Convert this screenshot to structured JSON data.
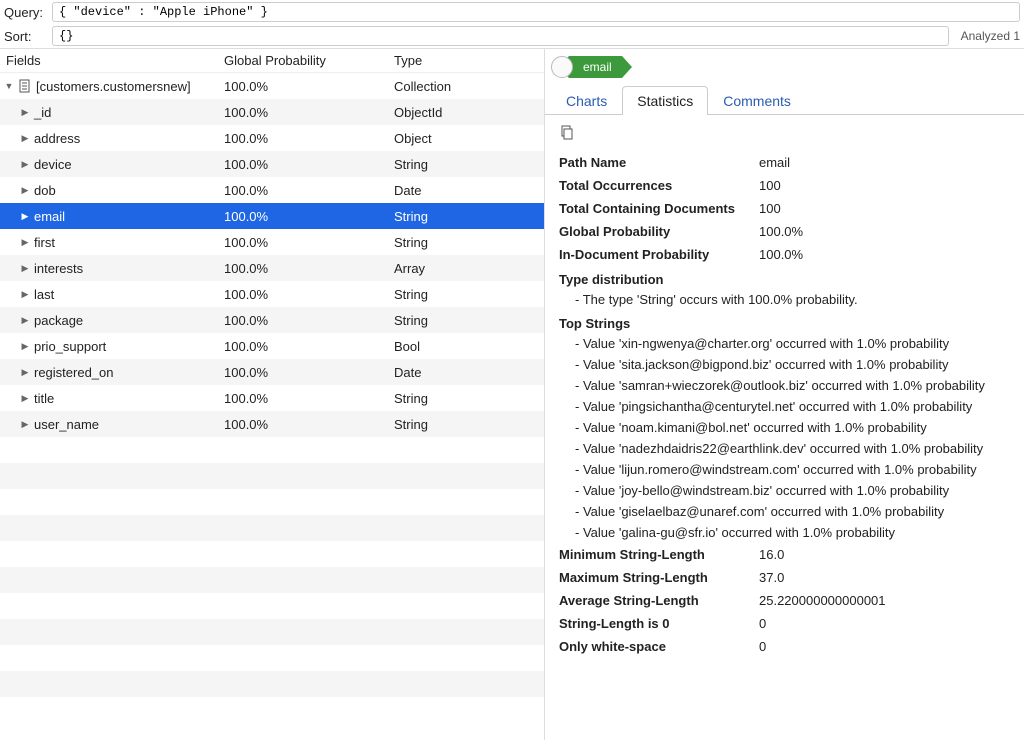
{
  "topbar": {
    "query_label": "Query:",
    "query_value": "{ \"device\" : \"Apple iPhone\" }",
    "sort_label": "Sort:",
    "sort_value": "{}",
    "analyzed_text": "Analyzed 1"
  },
  "columns": {
    "c1": "Fields",
    "c2": "Global Probability",
    "c3": "Type"
  },
  "rows": [
    {
      "name": "[customers.customersnew]",
      "prob": "100.0%",
      "type": "Collection",
      "depth": 0,
      "expanded": true,
      "hasIcon": true
    },
    {
      "name": "_id",
      "prob": "100.0%",
      "type": "ObjectId",
      "depth": 1,
      "expanded": false
    },
    {
      "name": "address",
      "prob": "100.0%",
      "type": "Object",
      "depth": 1,
      "expanded": false
    },
    {
      "name": "device",
      "prob": "100.0%",
      "type": "String",
      "depth": 1,
      "expanded": false
    },
    {
      "name": "dob",
      "prob": "100.0%",
      "type": "Date",
      "depth": 1,
      "expanded": false
    },
    {
      "name": "email",
      "prob": "100.0%",
      "type": "String",
      "depth": 1,
      "expanded": false,
      "selected": true
    },
    {
      "name": "first",
      "prob": "100.0%",
      "type": "String",
      "depth": 1,
      "expanded": false
    },
    {
      "name": "interests",
      "prob": "100.0%",
      "type": "Array",
      "depth": 1,
      "expanded": false
    },
    {
      "name": "last",
      "prob": "100.0%",
      "type": "String",
      "depth": 1,
      "expanded": false
    },
    {
      "name": "package",
      "prob": "100.0%",
      "type": "String",
      "depth": 1,
      "expanded": false
    },
    {
      "name": "prio_support",
      "prob": "100.0%",
      "type": "Bool",
      "depth": 1,
      "expanded": false
    },
    {
      "name": "registered_on",
      "prob": "100.0%",
      "type": "Date",
      "depth": 1,
      "expanded": false
    },
    {
      "name": "title",
      "prob": "100.0%",
      "type": "String",
      "depth": 1,
      "expanded": false
    },
    {
      "name": "user_name",
      "prob": "100.0%",
      "type": "String",
      "depth": 1,
      "expanded": false
    }
  ],
  "crumb": {
    "label": "email"
  },
  "tabs": [
    {
      "label": "Charts",
      "active": false
    },
    {
      "label": "Statistics",
      "active": true
    },
    {
      "label": "Comments",
      "active": false
    }
  ],
  "stats": {
    "simple": [
      {
        "label": "Path Name",
        "value": "email"
      },
      {
        "label": "Total Occurrences",
        "value": "100"
      },
      {
        "label": "Total Containing Documents",
        "value": "100"
      },
      {
        "label": "Global Probability",
        "value": "100.0%"
      },
      {
        "label": "In-Document Probability",
        "value": "100.0%"
      }
    ],
    "type_dist_head": "Type distribution",
    "type_dist_items": [
      "- The type 'String' occurs with 100.0% probability."
    ],
    "top_strings_head": "Top Strings",
    "top_strings_items": [
      "- Value 'xin-ngwenya@charter.org' occurred with 1.0% probability",
      "- Value 'sita.jackson@bigpond.biz' occurred with 1.0% probability",
      "- Value 'samran+wieczorek@outlook.biz' occurred with 1.0% probability",
      "- Value 'pingsichantha@centurytel.net' occurred with 1.0% probability",
      "- Value 'noam.kimani@bol.net' occurred with 1.0% probability",
      "- Value 'nadezhdaidris22@earthlink.dev' occurred with 1.0% probability",
      "- Value 'lijun.romero@windstream.com' occurred with 1.0% probability",
      "- Value 'joy-bello@windstream.biz' occurred with 1.0% probability",
      "- Value 'giselaelbaz@unaref.com' occurred with 1.0% probability",
      "- Value 'galina-gu@sfr.io' occurred with 1.0% probability"
    ],
    "tail": [
      {
        "label": "Minimum String-Length",
        "value": "16.0"
      },
      {
        "label": "Maximum String-Length",
        "value": "37.0"
      },
      {
        "label": "Average String-Length",
        "value": "25.220000000000001"
      },
      {
        "label": "String-Length is 0",
        "value": "0"
      },
      {
        "label": "Only white-space",
        "value": "0"
      }
    ]
  }
}
